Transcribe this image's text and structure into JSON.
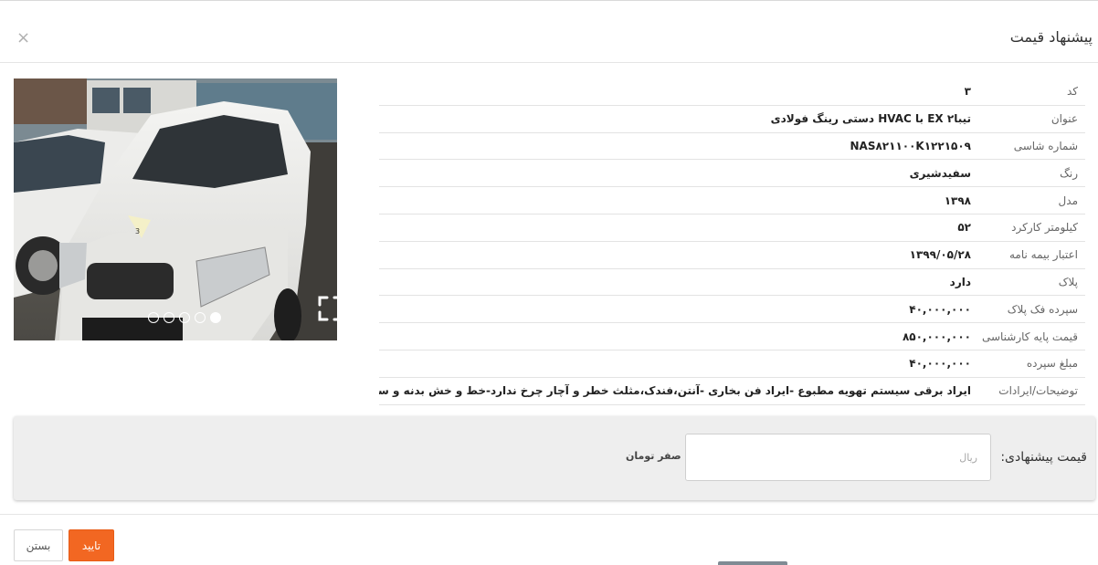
{
  "modal": {
    "title": "پیشنهاد قیمت",
    "close_glyph": "×"
  },
  "gallery": {
    "total_images": 5,
    "active_image": 5,
    "fullscreen_icon": "expand-icon",
    "sticker_text": "3"
  },
  "info_rows": [
    {
      "label": "کد",
      "value": "۳"
    },
    {
      "label": "عنوان",
      "value": "تیبا۲ EX با HVAC دستی رینگ فولادی"
    },
    {
      "label": "شماره شاسی",
      "value": "NAS۸۲۱۱۰۰K۱۲۲۱۵۰۹"
    },
    {
      "label": "رنگ",
      "value": "سفیدشیری"
    },
    {
      "label": "مدل",
      "value": "۱۳۹۸"
    },
    {
      "label": "کیلومتر کارکرد",
      "value": "۵۲"
    },
    {
      "label": "اعتبار بیمه نامه",
      "value": "۱۳۹۹/۰۵/۲۸"
    },
    {
      "label": "پلاک",
      "value": "دارد"
    },
    {
      "label": "سپرده فک پلاک",
      "value": "۴۰,۰۰۰,۰۰۰"
    },
    {
      "label": "قیمت پایه کارشناسی",
      "value": "۸۵۰,۰۰۰,۰۰۰"
    },
    {
      "label": "مبلغ سپرده",
      "value": "۴۰,۰۰۰,۰۰۰"
    },
    {
      "label": "توضیحات/ایرادات",
      "value": "ایراد برقی سیستم تهویه مطبوع -ایراد فن بخاری -آنتن،فندک،مثلث خطر و آچار چرخ ندارد-خط و خش بدنه و سپرها،درب جعبه فیوز"
    }
  ],
  "offer": {
    "label": "قیمت پیشنهادی:",
    "input_value": "",
    "input_placeholder": "ریال",
    "amount_in_words": "صفر تومان"
  },
  "footer": {
    "confirm_label": "تایید",
    "close_label": "بستن",
    "confirm_color": "#f26722"
  }
}
